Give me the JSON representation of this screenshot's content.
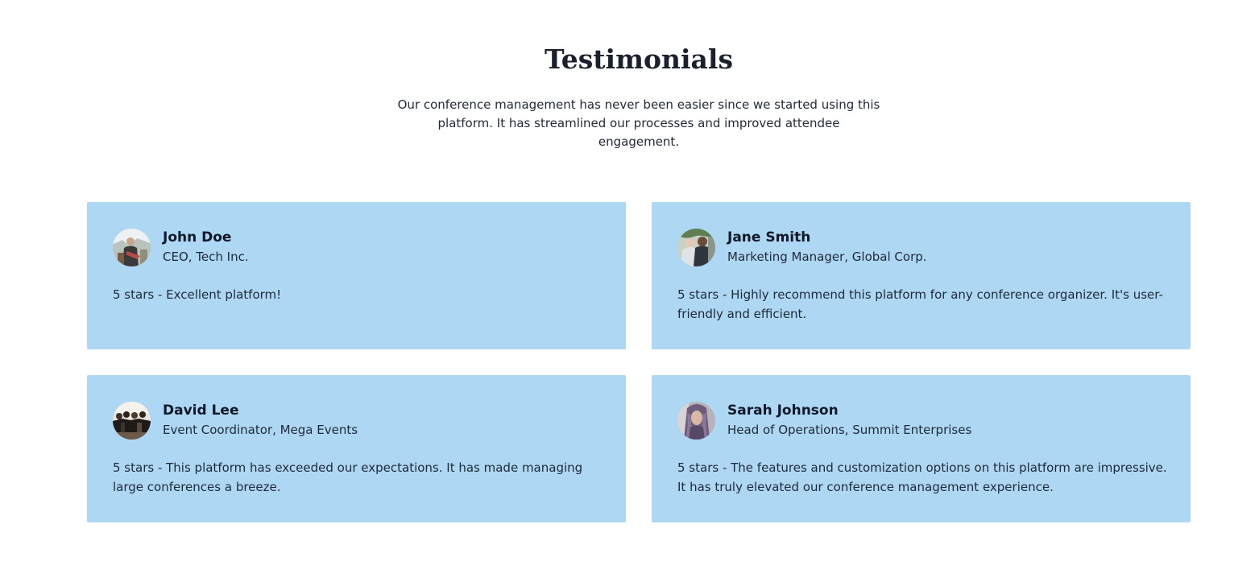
{
  "section": {
    "title": "Testimonials",
    "subtitle": "Our conference management has never been easier since we started using this platform. It has streamlined our processes and improved attendee engagement."
  },
  "testimonials": [
    {
      "name": "John Doe",
      "role": "CEO, Tech Inc.",
      "quote": "5 stars - Excellent platform!",
      "avatar_icon": "person-photo-avatar"
    },
    {
      "name": "Jane Smith",
      "role": "Marketing Manager, Global Corp.",
      "quote": "5 stars - Highly recommend this platform for any conference organizer. It's user-friendly and efficient.",
      "avatar_icon": "person-photo-avatar"
    },
    {
      "name": "David Lee",
      "role": "Event Coordinator, Mega Events",
      "quote": "5 stars - This platform has exceeded our expectations. It has made managing large conferences a breeze.",
      "avatar_icon": "group-photo-avatar"
    },
    {
      "name": "Sarah Johnson",
      "role": "Head of Operations, Summit Enterprises",
      "quote": "5 stars - The features and customization options on this platform are impressive. It has truly elevated our conference management experience.",
      "avatar_icon": "person-photo-avatar"
    }
  ],
  "colors": {
    "card_background": "#aed7f3",
    "heading": "#1a202c",
    "text": "#1f2937"
  }
}
